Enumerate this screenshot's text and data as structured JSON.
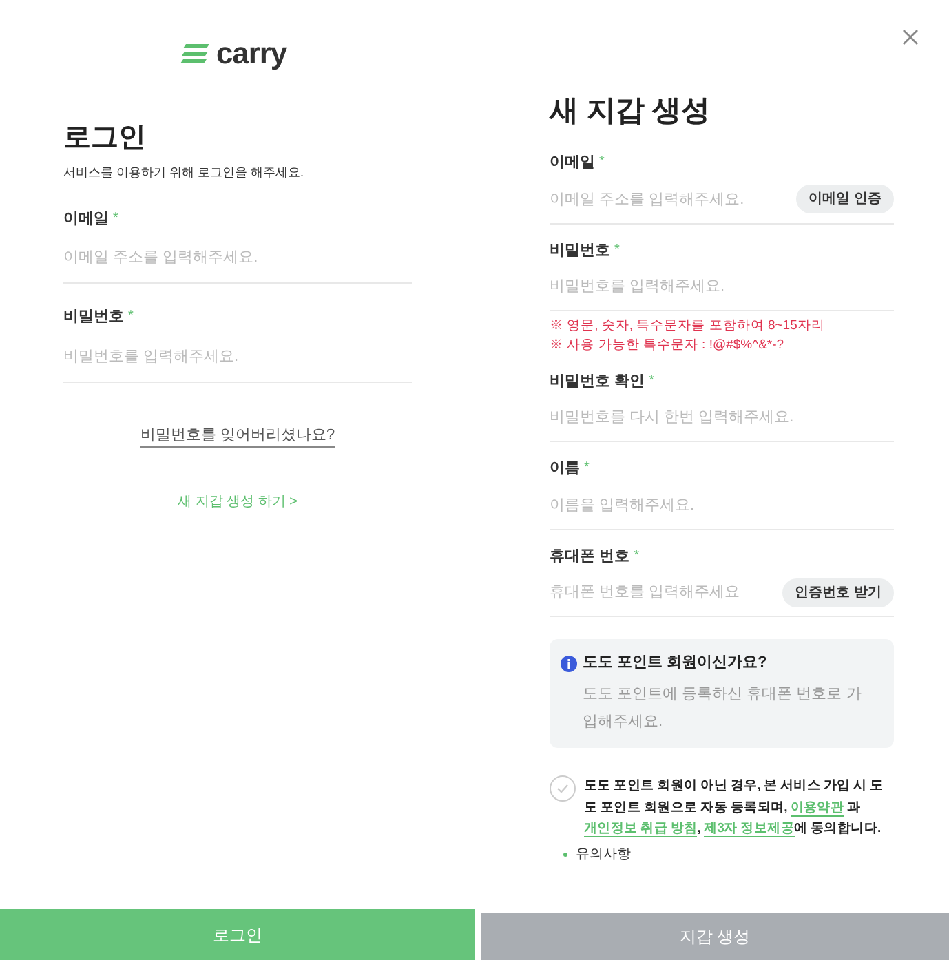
{
  "logo": {
    "text": "carry"
  },
  "login": {
    "title": "로그인",
    "subtitle": "서비스를 이용하기 위해 로그인을 해주세요.",
    "fields": [
      {
        "label": "이메일",
        "mark": "*",
        "placeholder": "이메일 주소를 입력해주세요."
      },
      {
        "label": "비밀번호",
        "mark": "*",
        "placeholder": "비밀번호를 입력해주세요."
      }
    ],
    "forgot_link": "비밀번호를 잊어버리셨나요?",
    "create_link": "새 지갑 생성 하기 >",
    "button": {
      "label": "로그인",
      "disabled": false
    }
  },
  "signup": {
    "title": "새 지갑 생성",
    "fields": [
      {
        "label": "이메일",
        "mark": "*",
        "placeholder": "이메일 주소를 입력해주세요.",
        "action": "이메일 인증"
      },
      {
        "label": "비밀번호",
        "mark": "*",
        "placeholder": "비밀번호를 입력해주세요.",
        "notes": [
          "※ 영문, 숫자, 특수문자를 포함하여 8~15자리",
          "※ 사용 가능한 특수문자 : !@#$%^&*-?"
        ]
      },
      {
        "label": "비밀번호 확인",
        "mark": "*",
        "placeholder": "비밀번호를 다시 한번 입력해주세요."
      },
      {
        "label": "이름",
        "mark": "*",
        "placeholder": "이름을 입력해주세요."
      },
      {
        "label": "휴대폰 번호",
        "mark": "*",
        "placeholder": "휴대폰 번호를 입력해주세요",
        "action": "인증번호 받기"
      }
    ],
    "info": {
      "title": "도도 포인트 회원이신가요?",
      "text": "도도 포인트에 등록하신 휴대폰 번호로 가입해주세요."
    },
    "agreement": {
      "checked": false,
      "segments": [
        {
          "kind": "plain",
          "text": "도도 포인트 회원이 아닌 경우, 본 서비스 가입 시 도도 포인트 회원으로 자동 등록되며, "
        },
        {
          "kind": "link",
          "text": "이용약관"
        },
        {
          "kind": "plain",
          "text": " 과 "
        },
        {
          "kind": "link",
          "text": "개인정보 취급 방침"
        },
        {
          "kind": "plain",
          "text": ", "
        },
        {
          "kind": "link",
          "text": "제3자 정보제공"
        },
        {
          "kind": "plain",
          "text": "에 동의합니다."
        }
      ]
    },
    "notice_heading": "유의사항",
    "button": {
      "label": "지갑 생성",
      "disabled": true
    }
  }
}
